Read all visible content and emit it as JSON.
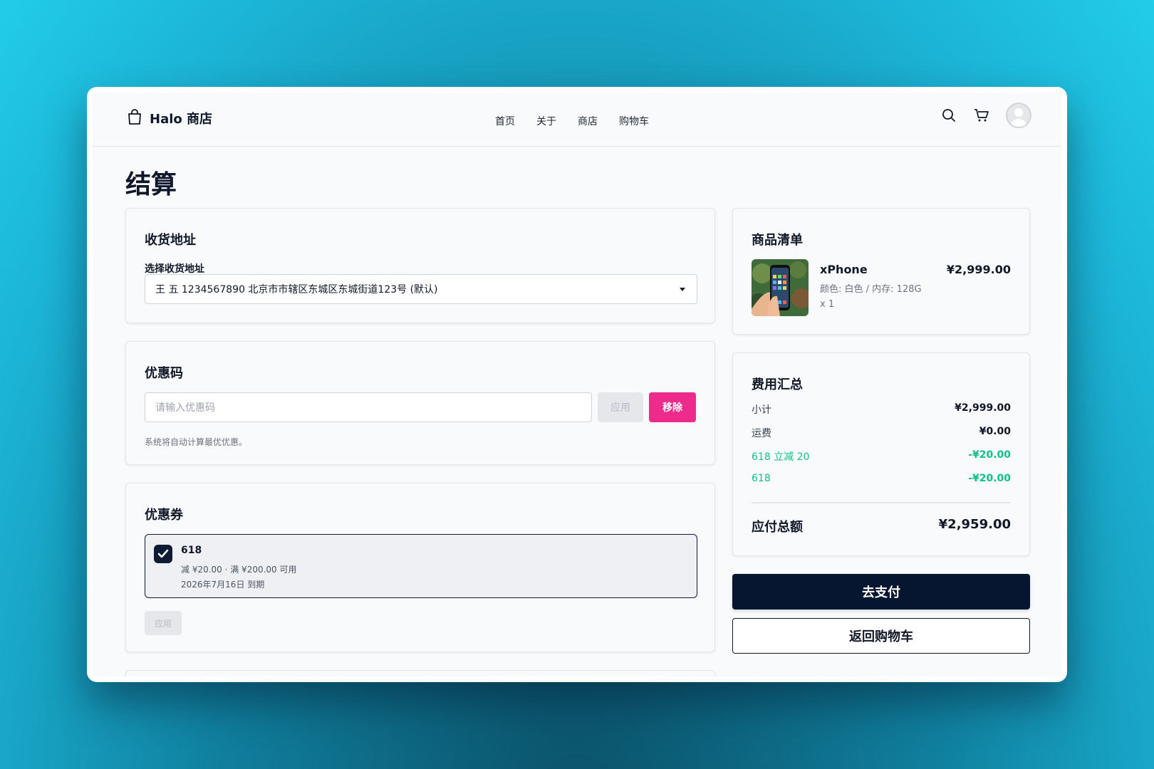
{
  "header": {
    "brand": "Halo 商店",
    "nav": [
      "首页",
      "关于",
      "商店",
      "购物车"
    ],
    "icons": [
      "shopping-bag-icon",
      "search-icon",
      "cart-icon",
      "avatar"
    ]
  },
  "page": {
    "title": "结算"
  },
  "address": {
    "title": "收货地址",
    "label": "选择收货地址",
    "selected": "王 五 1234567890 北京市市辖区东城区东城街道123号 (默认)"
  },
  "coupon_code": {
    "title": "优惠码",
    "placeholder": "请输入优惠码",
    "apply_label": "应用",
    "remove_label": "移除",
    "hint": "系统将自动计算最优优惠。"
  },
  "vouchers": {
    "title": "优惠券",
    "items": [
      {
        "name": "618",
        "desc": "减 ¥20.00 · 满 ¥200.00 可用",
        "expiry": "2026年7月16日 到期",
        "checked": true
      }
    ],
    "apply_label": "应用"
  },
  "items": {
    "title": "商品清单",
    "products": [
      {
        "name": "xPhone",
        "price": "¥2,999.00",
        "attrs": "颜色: 白色 / 内存: 128G",
        "qty": "x 1"
      }
    ]
  },
  "summary": {
    "title": "费用汇总",
    "rows": [
      {
        "label": "小计",
        "value": "¥2,999.00"
      },
      {
        "label": "运费",
        "value": "¥0.00"
      },
      {
        "label": "618 立减 20",
        "value": "-¥20.00"
      },
      {
        "label": "618",
        "value": "-¥20.00"
      }
    ],
    "total_label": "应付总额",
    "total_value": "¥2,959.00"
  },
  "buttons": {
    "pay": "去支付",
    "back": "返回购物车"
  },
  "colors": {
    "primary": "#061630",
    "remove": "#ec2b8c",
    "discount": "#10c08a"
  }
}
